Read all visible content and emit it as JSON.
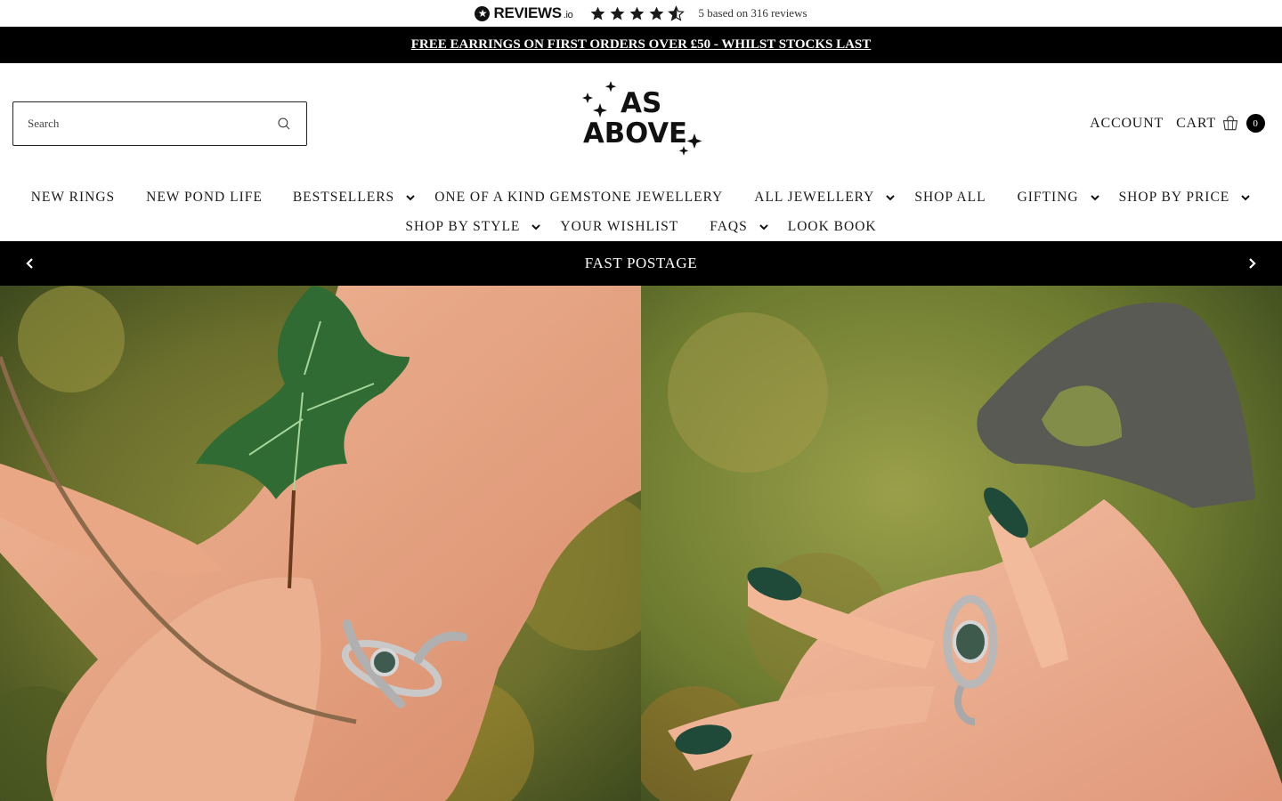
{
  "reviews": {
    "brand": "REVIEWS",
    "brand_suffix": ".io",
    "rating_text": "5 based on 316 reviews",
    "stars": 4.5,
    "star_color": "#1a1a1a"
  },
  "promo": {
    "text": "FREE EARRINGS ON FIRST ORDERS OVER £50 - WHILST STOCKS LAST"
  },
  "search": {
    "placeholder": "Search"
  },
  "logo": {
    "line1": "AS",
    "line2": "ABOVE"
  },
  "header": {
    "account_label": "ACCOUNT",
    "cart_label": "CART",
    "cart_count": "0"
  },
  "nav": {
    "row1": [
      {
        "label": "NEW RINGS",
        "dropdown": false
      },
      {
        "label": "NEW POND LIFE",
        "dropdown": false
      },
      {
        "label": "BESTSELLERS",
        "dropdown": true
      },
      {
        "label": "ONE OF A KIND GEMSTONE JEWELLERY",
        "dropdown": false
      },
      {
        "label": "ALL JEWELLERY",
        "dropdown": true
      },
      {
        "label": "SHOP ALL",
        "dropdown": false
      },
      {
        "label": "GIFTING",
        "dropdown": true
      },
      {
        "label": "SHOP BY PRICE",
        "dropdown": true
      }
    ],
    "row2": [
      {
        "label": "SHOP BY STYLE",
        "dropdown": true
      },
      {
        "label": "YOUR WISHLIST",
        "dropdown": false
      },
      {
        "label": "FAQS",
        "dropdown": true
      },
      {
        "label": "LOOK BOOK",
        "dropdown": false
      }
    ]
  },
  "announcement": {
    "text": "FAST POSTAGE"
  },
  "colors": {
    "black": "#000000",
    "moss": "#7a7a2e",
    "skin": "#e3a482",
    "ivy": "#2f6b33",
    "nail": "#1f4a3a"
  }
}
